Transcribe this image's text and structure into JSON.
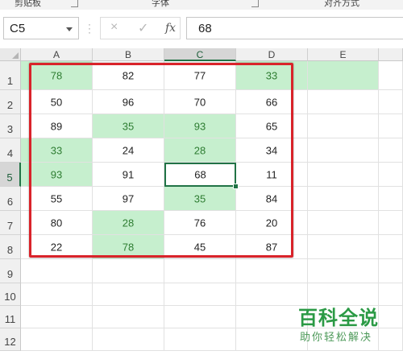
{
  "ribbon": {
    "groups": [
      "剪贴板",
      "字体",
      "对齐方式"
    ]
  },
  "formula_bar": {
    "name_box": "C5",
    "cancel_icon": "×",
    "enter_icon": "✓",
    "fx_label": "fx",
    "value": "68"
  },
  "sheet": {
    "columns": [
      "A",
      "B",
      "C",
      "D",
      "E"
    ],
    "rows": [
      "1",
      "2",
      "3",
      "4",
      "5",
      "6",
      "7",
      "8",
      "9",
      "10",
      "11",
      "12"
    ],
    "active_cell": "C5",
    "data": [
      [
        "78",
        "82",
        "77",
        "33"
      ],
      [
        "50",
        "96",
        "70",
        "66"
      ],
      [
        "89",
        "35",
        "93",
        "65"
      ],
      [
        "33",
        "24",
        "28",
        "34"
      ],
      [
        "93",
        "91",
        "68",
        "11"
      ],
      [
        "55",
        "97",
        "35",
        "84"
      ],
      [
        "80",
        "28",
        "76",
        "20"
      ],
      [
        "22",
        "78",
        "45",
        "87"
      ]
    ],
    "highlight_color": "#c6efce",
    "highlight_text_color": "#2e7d32",
    "annotation_border_color": "#d9232a"
  },
  "watermark": {
    "title": "百科全说",
    "subtitle": "助你轻松解决"
  }
}
